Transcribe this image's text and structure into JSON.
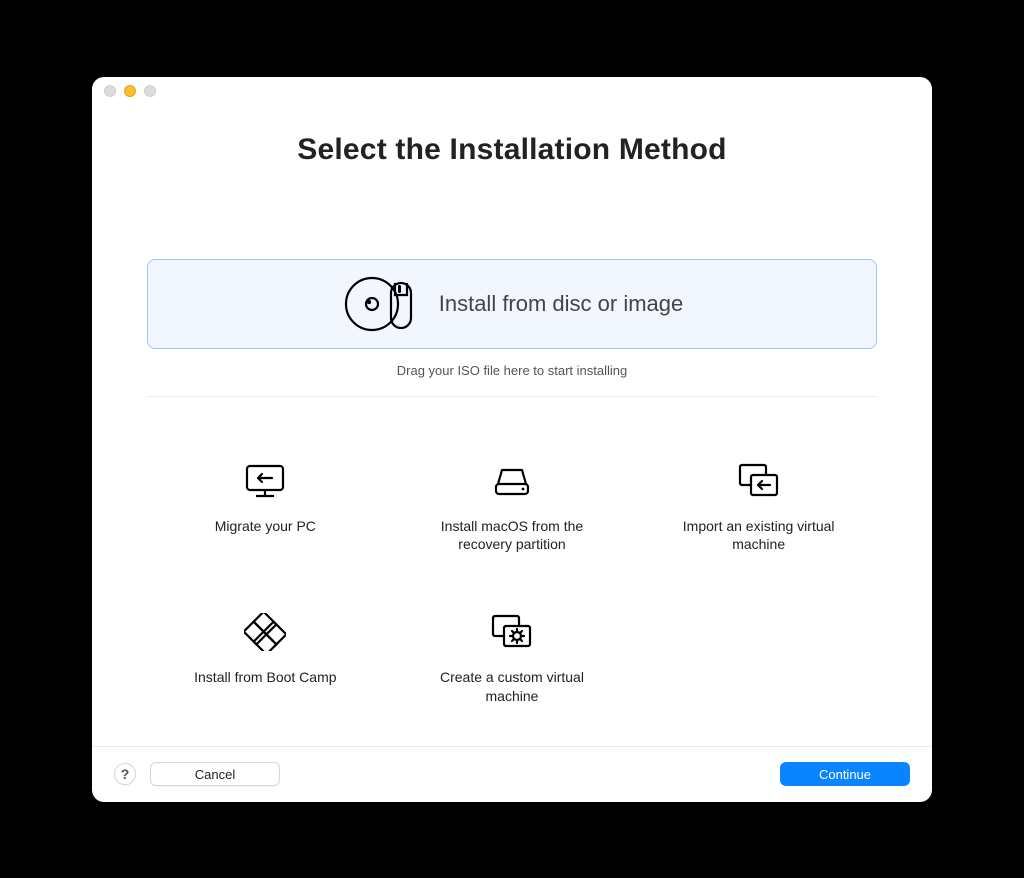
{
  "header": {
    "title": "Select the Installation Method"
  },
  "primary_option": {
    "label": "Install from disc or image",
    "hint": "Drag your ISO file here to start installing"
  },
  "options": {
    "migrate_pc": {
      "label": "Migrate your PC"
    },
    "install_macos": {
      "label": "Install macOS from the recovery partition"
    },
    "import_vm": {
      "label": "Import an existing virtual machine"
    },
    "bootcamp": {
      "label": "Install from Boot Camp"
    },
    "custom_vm": {
      "label": "Create a custom virtual machine"
    }
  },
  "footer": {
    "help": "?",
    "cancel": "Cancel",
    "continue": "Continue"
  }
}
